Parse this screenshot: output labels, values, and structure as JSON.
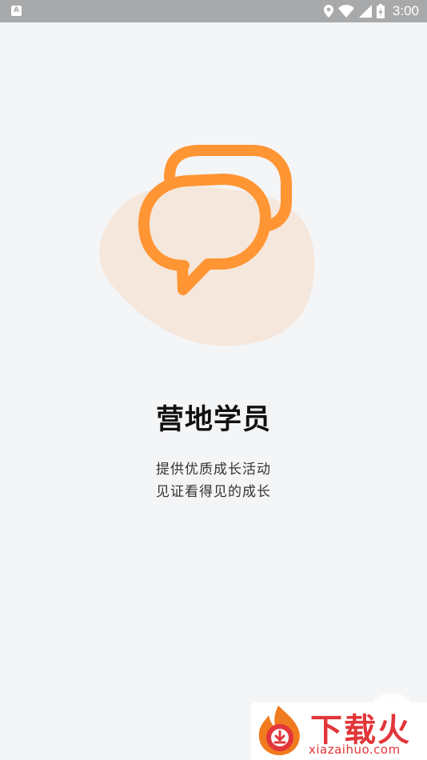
{
  "status_bar": {
    "notification_icon": "A",
    "time": "3:00",
    "icons": [
      "location-icon",
      "wifi-icon",
      "signal-icon",
      "battery-icon"
    ]
  },
  "splash": {
    "title": "营地学员",
    "subtitle_line1": "提供优质成长活动",
    "subtitle_line2": "见证看得见的成长",
    "illustration": "chat-bubbles-icon"
  },
  "watermark": {
    "brand": "下载火",
    "url": "xiazaihuo.com"
  },
  "colors": {
    "accent": "#ff9533",
    "blob": "#f5e7dc",
    "background": "#f4f5f7",
    "status_bar": "#a8a9ab",
    "watermark_red": "#e2363a"
  }
}
